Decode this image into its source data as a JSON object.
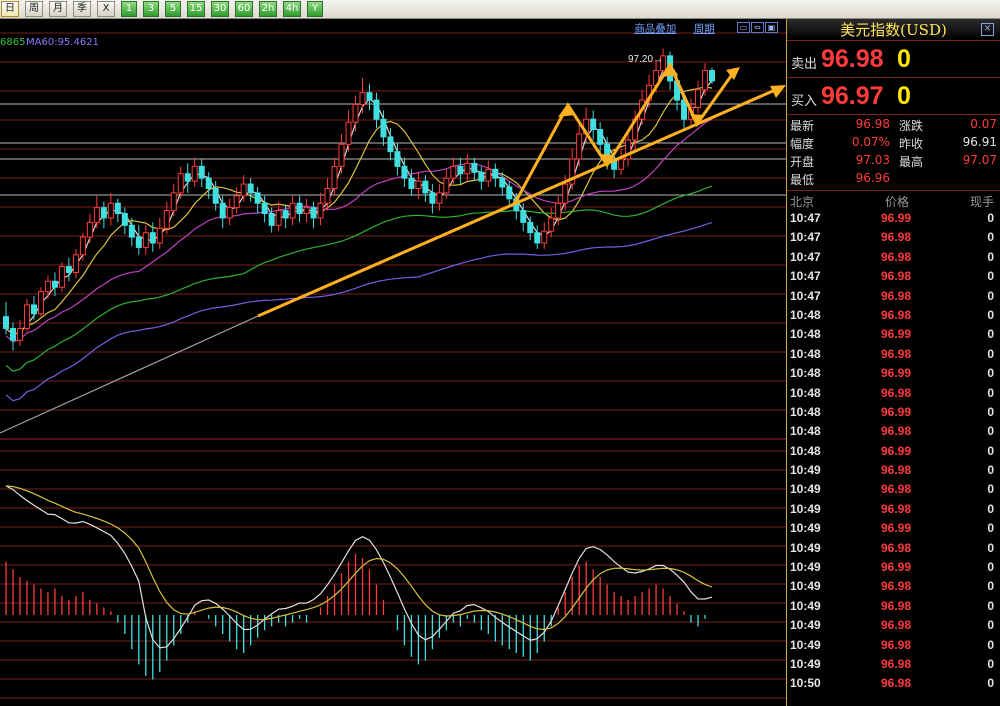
{
  "toolbar": {
    "buttons": [
      {
        "label": "日",
        "style": "selected"
      },
      {
        "label": "周",
        "style": "normal"
      },
      {
        "label": "月",
        "style": "normal"
      },
      {
        "label": "季",
        "style": "normal"
      },
      {
        "label": "X",
        "style": "normal"
      },
      {
        "label": "1",
        "style": "green"
      },
      {
        "label": "3",
        "style": "green"
      },
      {
        "label": "5",
        "style": "green"
      },
      {
        "label": "15",
        "style": "green"
      },
      {
        "label": "30",
        "style": "green"
      },
      {
        "label": "60",
        "style": "green"
      },
      {
        "label": "2h",
        "style": "green"
      },
      {
        "label": "4h",
        "style": "green"
      },
      {
        "label": "Y",
        "style": "green"
      }
    ]
  },
  "chart": {
    "ma_labels": [
      {
        "text": "6865",
        "color": "#36c936"
      },
      {
        "text": "MA60:95.4621",
        "color": "#8f7bff"
      }
    ],
    "header_links": [
      "商品叠加",
      "周期"
    ],
    "peak_annotation": "97.20→",
    "colors": {
      "candle_up": "#ff3b3b",
      "candle_down": "#40e0e0",
      "grid": "#7a1f1f",
      "ma_white": "#d8d8d8",
      "ma_yellow": "#d8c040",
      "ma_magenta": "#c040c0",
      "ma_green": "#30b030",
      "ma_purple": "#7060e0",
      "arrow": "#ffb020"
    },
    "candles": [
      [
        95.38,
        95.3,
        95.48,
        95.26
      ],
      [
        95.3,
        95.22,
        95.34,
        95.15
      ],
      [
        95.22,
        95.3,
        95.36,
        95.18
      ],
      [
        95.3,
        95.46,
        95.5,
        95.28
      ],
      [
        95.46,
        95.4,
        95.52,
        95.36
      ],
      [
        95.4,
        95.55,
        95.58,
        95.38
      ],
      [
        95.55,
        95.62,
        95.66,
        95.5
      ],
      [
        95.62,
        95.58,
        95.68,
        95.52
      ],
      [
        95.58,
        95.72,
        95.75,
        95.55
      ],
      [
        95.72,
        95.68,
        95.78,
        95.62
      ],
      [
        95.68,
        95.8,
        95.84,
        95.64
      ],
      [
        95.8,
        95.92,
        95.95,
        95.76
      ],
      [
        95.92,
        96.02,
        96.08,
        95.88
      ],
      [
        96.02,
        96.12,
        96.2,
        95.98
      ],
      [
        96.12,
        96.05,
        96.16,
        95.98
      ],
      [
        96.05,
        96.15,
        96.22,
        96.0
      ],
      [
        96.15,
        96.08,
        96.18,
        96.02
      ],
      [
        96.08,
        96.0,
        96.12,
        95.94
      ],
      [
        96.0,
        95.92,
        96.05,
        95.86
      ],
      [
        95.92,
        95.85,
        96.0,
        95.8
      ],
      [
        95.85,
        95.95,
        96.0,
        95.8
      ],
      [
        95.95,
        95.88,
        96.02,
        95.82
      ],
      [
        95.88,
        95.98,
        96.05,
        95.84
      ],
      [
        95.98,
        96.1,
        96.16,
        95.94
      ],
      [
        96.1,
        96.22,
        96.28,
        96.06
      ],
      [
        96.22,
        96.35,
        96.4,
        96.18
      ],
      [
        96.35,
        96.3,
        96.42,
        96.22
      ],
      [
        96.3,
        96.4,
        96.46,
        96.26
      ],
      [
        96.4,
        96.32,
        96.45,
        96.26
      ],
      [
        96.32,
        96.25,
        96.36,
        96.18
      ],
      [
        96.25,
        96.15,
        96.3,
        96.1
      ],
      [
        96.15,
        96.05,
        96.2,
        95.98
      ],
      [
        96.05,
        96.12,
        96.18,
        96.0
      ],
      [
        96.12,
        96.2,
        96.26,
        96.08
      ],
      [
        96.2,
        96.28,
        96.34,
        96.16
      ],
      [
        96.28,
        96.22,
        96.32,
        96.16
      ],
      [
        96.22,
        96.15,
        96.26,
        96.08
      ],
      [
        96.15,
        96.08,
        96.2,
        96.02
      ],
      [
        96.08,
        96.0,
        96.12,
        95.95
      ],
      [
        96.0,
        96.1,
        96.16,
        95.96
      ],
      [
        96.1,
        96.05,
        96.14,
        95.98
      ],
      [
        96.05,
        96.15,
        96.2,
        96.0
      ],
      [
        96.15,
        96.08,
        96.2,
        96.02
      ],
      [
        96.08,
        96.12,
        96.18,
        96.02
      ],
      [
        96.12,
        96.05,
        96.16,
        95.98
      ],
      [
        96.05,
        96.15,
        96.22,
        96.0
      ],
      [
        96.15,
        96.25,
        96.32,
        96.1
      ],
      [
        96.25,
        96.4,
        96.46,
        96.2
      ],
      [
        96.4,
        96.55,
        96.62,
        96.35
      ],
      [
        96.55,
        96.7,
        96.78,
        96.5
      ],
      [
        96.7,
        96.82,
        96.88,
        96.64
      ],
      [
        96.82,
        96.9,
        97.0,
        96.76
      ],
      [
        96.9,
        96.85,
        96.96,
        96.78
      ],
      [
        96.85,
        96.72,
        96.9,
        96.66
      ],
      [
        96.72,
        96.6,
        96.78,
        96.54
      ],
      [
        96.6,
        96.5,
        96.66,
        96.44
      ],
      [
        96.5,
        96.4,
        96.56,
        96.34
      ],
      [
        96.4,
        96.32,
        96.46,
        96.26
      ],
      [
        96.32,
        96.25,
        96.38,
        96.2
      ],
      [
        96.25,
        96.3,
        96.36,
        96.18
      ],
      [
        96.3,
        96.22,
        96.34,
        96.16
      ],
      [
        96.22,
        96.15,
        96.28,
        96.08
      ],
      [
        96.15,
        96.22,
        96.28,
        96.1
      ],
      [
        96.22,
        96.32,
        96.38,
        96.18
      ],
      [
        96.32,
        96.4,
        96.46,
        96.28
      ],
      [
        96.4,
        96.35,
        96.46,
        96.28
      ],
      [
        96.35,
        96.42,
        96.48,
        96.3
      ],
      [
        96.42,
        96.36,
        96.46,
        96.3
      ],
      [
        96.36,
        96.3,
        96.4,
        96.24
      ],
      [
        96.3,
        96.38,
        96.44,
        96.26
      ],
      [
        96.38,
        96.32,
        96.42,
        96.26
      ],
      [
        96.32,
        96.26,
        96.36,
        96.2
      ],
      [
        96.26,
        96.18,
        96.3,
        96.12
      ],
      [
        96.18,
        96.1,
        96.22,
        96.04
      ],
      [
        96.1,
        96.02,
        96.15,
        95.96
      ],
      [
        96.02,
        95.95,
        96.06,
        95.9
      ],
      [
        95.95,
        95.88,
        96.0,
        95.84
      ],
      [
        95.88,
        95.96,
        96.02,
        95.84
      ],
      [
        95.96,
        96.05,
        96.12,
        95.92
      ],
      [
        96.05,
        96.15,
        96.2,
        96.0
      ],
      [
        96.15,
        96.28,
        96.34,
        96.1
      ],
      [
        96.28,
        96.45,
        96.52,
        96.24
      ],
      [
        96.45,
        96.62,
        96.7,
        96.4
      ],
      [
        96.62,
        96.72,
        96.8,
        96.56
      ],
      [
        96.72,
        96.65,
        96.78,
        96.58
      ],
      [
        96.65,
        96.55,
        96.7,
        96.48
      ],
      [
        96.55,
        96.45,
        96.6,
        96.38
      ],
      [
        96.45,
        96.38,
        96.5,
        96.32
      ],
      [
        96.38,
        96.45,
        96.52,
        96.34
      ],
      [
        96.45,
        96.58,
        96.64,
        96.4
      ],
      [
        96.58,
        96.72,
        96.78,
        96.52
      ],
      [
        96.72,
        96.85,
        96.92,
        96.68
      ],
      [
        96.85,
        96.95,
        97.02,
        96.8
      ],
      [
        96.95,
        97.05,
        97.12,
        96.9
      ],
      [
        97.05,
        97.15,
        97.2,
        97.0
      ],
      [
        97.15,
        96.98,
        97.18,
        96.92
      ],
      [
        96.98,
        96.85,
        97.02,
        96.78
      ],
      [
        96.85,
        96.72,
        96.9,
        96.66
      ],
      [
        96.72,
        96.8,
        96.86,
        96.66
      ],
      [
        96.8,
        96.92,
        96.98,
        96.76
      ],
      [
        96.92,
        97.05,
        97.1,
        96.88
      ],
      [
        97.05,
        96.98,
        97.07,
        96.96
      ]
    ],
    "macd": [
      0.14,
      0.12,
      0.1,
      0.09,
      0.08,
      0.07,
      0.06,
      0.07,
      0.05,
      0.04,
      0.05,
      0.06,
      0.04,
      0.03,
      0.02,
      0.01,
      -0.02,
      -0.05,
      -0.09,
      -0.13,
      -0.16,
      -0.17,
      -0.15,
      -0.12,
      -0.08,
      -0.05,
      -0.02,
      0.01,
      0.0,
      -0.01,
      -0.03,
      -0.05,
      -0.07,
      -0.09,
      -0.1,
      -0.08,
      -0.06,
      -0.04,
      -0.03,
      -0.02,
      -0.03,
      -0.02,
      -0.01,
      -0.02,
      0.0,
      0.02,
      0.05,
      0.08,
      0.11,
      0.14,
      0.16,
      0.15,
      0.12,
      0.08,
      0.04,
      0.0,
      -0.04,
      -0.08,
      -0.11,
      -0.13,
      -0.12,
      -0.09,
      -0.06,
      -0.04,
      -0.02,
      -0.03,
      -0.01,
      -0.02,
      -0.04,
      -0.05,
      -0.07,
      -0.08,
      -0.09,
      -0.1,
      -0.11,
      -0.12,
      -0.1,
      -0.07,
      -0.03,
      0.02,
      0.06,
      0.1,
      0.13,
      0.14,
      0.12,
      0.1,
      0.08,
      0.06,
      0.05,
      0.04,
      0.05,
      0.06,
      0.07,
      0.08,
      0.07,
      0.05,
      0.03,
      0.01,
      -0.02,
      -0.03,
      -0.01,
      0.0
    ]
  },
  "panel": {
    "title": "美元指数(USD)",
    "sell_label": "卖出",
    "sell_price": "96.98",
    "sell_vol": "0",
    "buy_label": "买入",
    "buy_price": "96.97",
    "buy_vol": "0",
    "stats": [
      {
        "k": "最新",
        "v": "96.98",
        "color": "#ff3b3b"
      },
      {
        "k": "涨跌",
        "v": "0.07",
        "color": "#ff3b3b"
      },
      {
        "k": "幅度",
        "v": "0.07%",
        "color": "#ff3b3b"
      },
      {
        "k": "昨收",
        "v": "96.91",
        "color": "#e6e6e6"
      },
      {
        "k": "开盘",
        "v": "97.03",
        "color": "#ff3b3b"
      },
      {
        "k": "最高",
        "v": "97.07",
        "color": "#ff3b3b"
      },
      {
        "k": "最低",
        "v": "96.96",
        "color": "#ff3b3b"
      }
    ],
    "ticks_head": {
      "time": "北京",
      "price": "价格",
      "vol": "现手"
    },
    "ticks": [
      {
        "t": "10:47",
        "p": "96.99",
        "v": "0"
      },
      {
        "t": "10:47",
        "p": "96.98",
        "v": "0"
      },
      {
        "t": "10:47",
        "p": "96.98",
        "v": "0"
      },
      {
        "t": "10:47",
        "p": "96.98",
        "v": "0"
      },
      {
        "t": "10:47",
        "p": "96.98",
        "v": "0"
      },
      {
        "t": "10:48",
        "p": "96.98",
        "v": "0"
      },
      {
        "t": "10:48",
        "p": "96.99",
        "v": "0"
      },
      {
        "t": "10:48",
        "p": "96.98",
        "v": "0"
      },
      {
        "t": "10:48",
        "p": "96.99",
        "v": "0"
      },
      {
        "t": "10:48",
        "p": "96.98",
        "v": "0"
      },
      {
        "t": "10:48",
        "p": "96.99",
        "v": "0"
      },
      {
        "t": "10:48",
        "p": "96.98",
        "v": "0"
      },
      {
        "t": "10:48",
        "p": "96.99",
        "v": "0"
      },
      {
        "t": "10:49",
        "p": "96.98",
        "v": "0"
      },
      {
        "t": "10:49",
        "p": "96.98",
        "v": "0"
      },
      {
        "t": "10:49",
        "p": "96.98",
        "v": "0"
      },
      {
        "t": "10:49",
        "p": "96.99",
        "v": "0"
      },
      {
        "t": "10:49",
        "p": "96.98",
        "v": "0"
      },
      {
        "t": "10:49",
        "p": "96.99",
        "v": "0"
      },
      {
        "t": "10:49",
        "p": "96.98",
        "v": "0"
      },
      {
        "t": "10:49",
        "p": "96.98",
        "v": "0"
      },
      {
        "t": "10:49",
        "p": "96.98",
        "v": "0"
      },
      {
        "t": "10:49",
        "p": "96.98",
        "v": "0"
      },
      {
        "t": "10:49",
        "p": "96.98",
        "v": "0"
      },
      {
        "t": "10:50",
        "p": "96.98",
        "v": "0"
      }
    ]
  }
}
